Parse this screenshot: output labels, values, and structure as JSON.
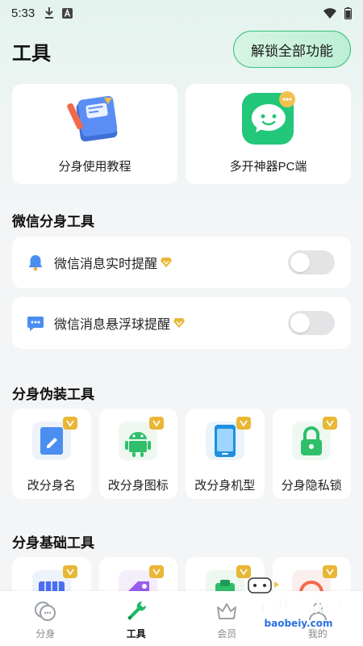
{
  "status_bar": {
    "time": "5:33",
    "icons": [
      "download-icon",
      "a-badge-icon",
      "wifi-icon",
      "battery-icon"
    ]
  },
  "header": {
    "title": "工具",
    "unlock_label": "解锁全部功能"
  },
  "top_cards": [
    {
      "label": "分身使用教程",
      "icon": "book-icon"
    },
    {
      "label": "多开神器PC端",
      "icon": "chat-bubble-icon"
    }
  ],
  "wechat_section": {
    "title": "微信分身工具",
    "rows": [
      {
        "label": "微信消息实时提醒",
        "icon": "bell-icon",
        "enabled": false
      },
      {
        "label": "微信消息悬浮球提醒",
        "icon": "message-bubble-icon",
        "enabled": false
      }
    ]
  },
  "disguise_section": {
    "title": "分身伪装工具",
    "items": [
      {
        "label": "改分身名",
        "icon": "edit-doc-icon"
      },
      {
        "label": "改分身图标",
        "icon": "android-icon"
      },
      {
        "label": "改分身机型",
        "icon": "phone-icon"
      },
      {
        "label": "分身隐私锁",
        "icon": "lock-icon"
      }
    ]
  },
  "basic_section": {
    "title": "分身基础工具"
  },
  "tab_bar": {
    "tabs": [
      {
        "label": "分身",
        "icon": "clone-chat-icon",
        "active": false
      },
      {
        "label": "工具",
        "icon": "wrench-icon",
        "active": true
      },
      {
        "label": "会员",
        "icon": "member-icon",
        "active": false
      },
      {
        "label": "我的",
        "icon": "profile-icon",
        "active": false
      }
    ]
  },
  "watermark": {
    "line1": "宝贝游戏网",
    "line2": "baobeiy.com"
  },
  "colors": {
    "accent": "#33c27a",
    "vip_gold": "#e8b735",
    "icon_blue": "#4a8ef0"
  }
}
